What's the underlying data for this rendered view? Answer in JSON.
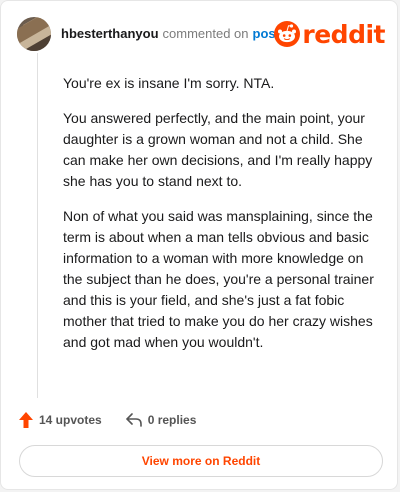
{
  "header": {
    "username": "hbesterthanyou",
    "commented_text": "commented on",
    "post_link": "post",
    "logo_text": "reddit"
  },
  "comment": {
    "paragraphs": [
      "You're ex is insane I'm sorry. NTA.",
      "You answered perfectly, and the main point, your daughter is a grown woman and not a child. She can make her own decisions, and I'm really happy she has you to stand next to.",
      "Non of what you said was mansplaining, since the term is about when a man tells obvious and basic information to a woman with more knowledge on the subject than he does, you're a personal trainer and this is your field, and she's just a fat fobic mother that tried to make you do her crazy wishes and got mad when you wouldn't."
    ]
  },
  "actions": {
    "upvotes": "14 upvotes",
    "replies": "0 replies"
  },
  "footer": {
    "view_more": "View more on Reddit"
  },
  "colors": {
    "brand": "#ff4500",
    "link": "#0079d3"
  },
  "icons": [
    "reddit-logo-icon",
    "upvote-arrow-icon",
    "reply-icon"
  ]
}
